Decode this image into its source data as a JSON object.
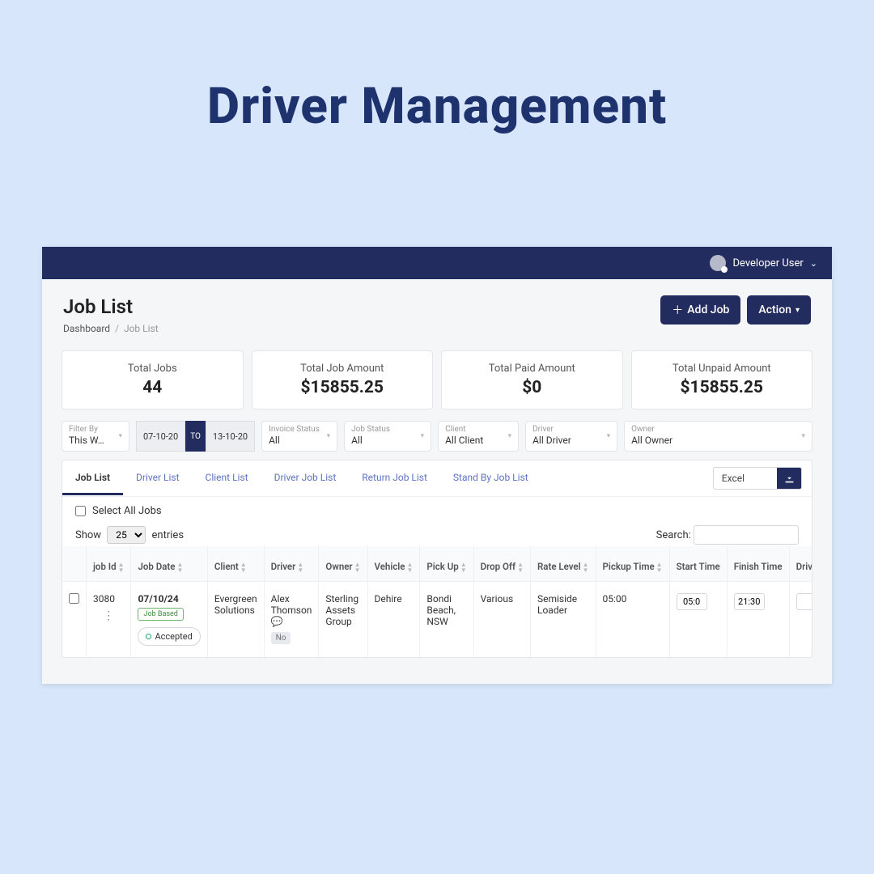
{
  "slideTitle": "Driver Management",
  "user": {
    "name": "Developer User"
  },
  "page": {
    "title": "Job List",
    "breadcrumb": {
      "root": "Dashboard",
      "current": "Job List"
    }
  },
  "buttons": {
    "addJob": "Add Job",
    "action": "Action"
  },
  "stats": [
    {
      "label": "Total Jobs",
      "value": "44"
    },
    {
      "label": "Total Job Amount",
      "value": "$15855.25"
    },
    {
      "label": "Total Paid Amount",
      "value": "$0"
    },
    {
      "label": "Total Unpaid Amount",
      "value": "$15855.25"
    }
  ],
  "filters": {
    "filterBy": {
      "label": "Filter By",
      "value": "This W…"
    },
    "dateFrom": "07-10-20",
    "dateTo": "13-10-20",
    "dateToLabel": "TO",
    "invoiceStatus": {
      "label": "Invoice Status",
      "value": "All"
    },
    "jobStatus": {
      "label": "Job Status",
      "value": "All"
    },
    "client": {
      "label": "Client",
      "value": "All Client"
    },
    "driver": {
      "label": "Driver",
      "value": "All Driver"
    },
    "owner": {
      "label": "Owner",
      "value": "All Owner"
    }
  },
  "tabs": [
    "Job List",
    "Driver List",
    "Client List",
    "Driver Job List",
    "Return Job List",
    "Stand By Job List"
  ],
  "tabsActiveIndex": 0,
  "export": {
    "label": "Excel"
  },
  "selectAllLabel": "Select All Jobs",
  "show": {
    "prefix": "Show",
    "value": "25",
    "suffix": "entries"
  },
  "searchLabel": "Search:",
  "columns": [
    "job Id",
    "Job Date",
    "Client",
    "Driver",
    "Owner",
    "Vehicle",
    "Pick Up",
    "Drop Off",
    "Rate Level",
    "Pickup Time",
    "Start Time",
    "Finish Time",
    "Driv Retu Hrs"
  ],
  "row": {
    "jobId": "3080",
    "jobDate": "07/10/24",
    "jobDateBadge": "Job Based",
    "statusPill": "Accepted",
    "client": "Evergreen Solutions",
    "driver": "Alex Thomson",
    "driverNoBadge": "No",
    "owner": "Sterling Assets Group",
    "vehicle": "Dehire",
    "pickUp": "Bondi Beach, NSW",
    "dropOff": "Various",
    "rateLevel": "Semiside Loader",
    "pickupTime": "05:00",
    "startTime": "05:0",
    "finishTime": "21:30"
  }
}
